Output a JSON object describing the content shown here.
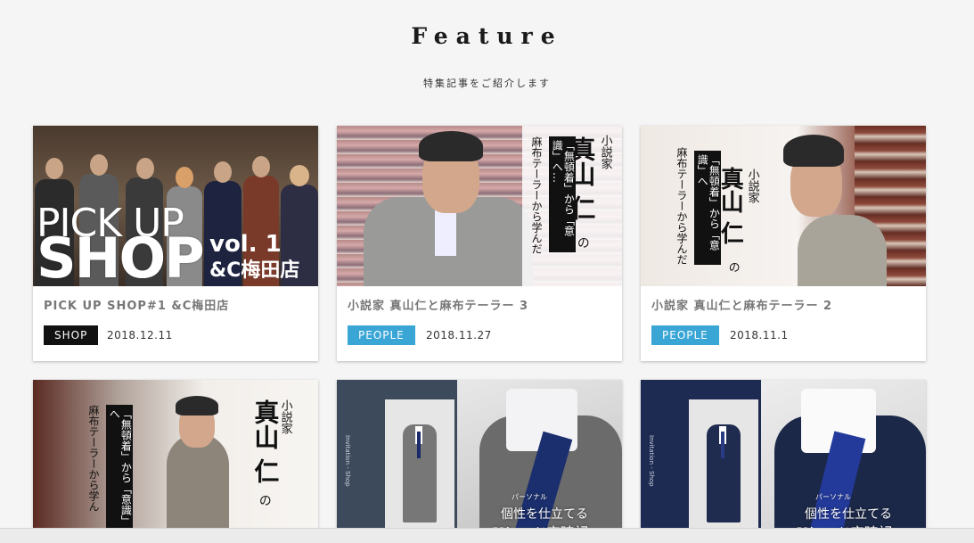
{
  "section": {
    "title": "Feature",
    "subtitle": "特集記事をご紹介します"
  },
  "cards": [
    {
      "title": "PICK UP SHOP#1 &C梅田店",
      "tag": "SHOP",
      "date": "2018.12.11",
      "thumb": {
        "line1": "PICK UP",
        "line2": "SHOP",
        "line3": "vol. 1",
        "line4": "&C梅田店"
      }
    },
    {
      "title": "小説家 真山仁と麻布テーラー 3",
      "tag": "PEOPLE",
      "date": "2018.11.27",
      "thumb": {
        "small": "小説家",
        "name": "真山 仁",
        "no": "の",
        "box": "「無頓着」から「意識」へ…",
        "plain": "麻布テーラーから学んだ"
      }
    },
    {
      "title": "小説家 真山仁と麻布テーラー 2",
      "tag": "PEOPLE",
      "date": "2018.11.1",
      "thumb": {
        "small": "小説家",
        "name": "真山 仁",
        "no": "の",
        "box": "「無頓着」から「意識」へ",
        "plain": "麻布テーラーから学んだ"
      }
    },
    {
      "thumb": {
        "small": "小説家",
        "name": "真山 仁",
        "no": "の",
        "box": "「無頓着」から「意識」へ",
        "plain": "麻布テーラーから学ん"
      }
    },
    {
      "thumb": {
        "caption_small": "パーソナル",
        "caption": "個性を仕立てる",
        "caption2": "Yシャツ店時記",
        "label": "Invitation - Shop"
      }
    },
    {
      "thumb": {
        "caption_small": "パーソナル",
        "caption": "個性を仕立てる",
        "caption2": "Yシャツ店時記",
        "label": "Invitation - Shop"
      }
    }
  ],
  "colors": {
    "shop_tag": "#111111",
    "people_tag": "#3aa6d6"
  }
}
